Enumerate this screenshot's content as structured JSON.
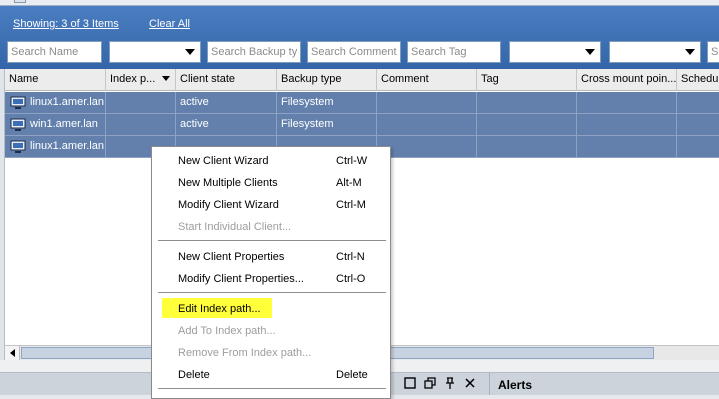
{
  "filter_bar": {
    "showing_label": "Showing: 3 of 3 Items",
    "clear_all_label": "Clear All",
    "search_name_placeholder": "Search Name",
    "search_backup_type_placeholder": "Search Backup typ",
    "search_comment_placeholder": "Search Comment",
    "search_tag_placeholder": "Search Tag",
    "search_last_placeholder": "Se"
  },
  "table": {
    "columns": [
      "Name",
      "Index p...",
      "Client state",
      "Backup type",
      "Comment",
      "Tag",
      "Cross mount poin...",
      "Schedu"
    ],
    "rows": [
      {
        "name": "linux1.amer.lan",
        "index_path": "",
        "client_state": "active",
        "backup_type": "Filesystem",
        "comment": "",
        "tag": "",
        "cross_mount": "",
        "schedule": ""
      },
      {
        "name": "win1.amer.lan",
        "index_path": "",
        "client_state": "active",
        "backup_type": "Filesystem",
        "comment": "",
        "tag": "",
        "cross_mount": "",
        "schedule": ""
      },
      {
        "name": "linux1.amer.lan",
        "index_path": "",
        "client_state": "",
        "backup_type": "",
        "comment": "",
        "tag": "",
        "cross_mount": "",
        "schedule": ""
      }
    ]
  },
  "context_menu": {
    "items": [
      {
        "label": "New Client Wizard",
        "shortcut": "Ctrl-W"
      },
      {
        "label": "New Multiple Clients",
        "shortcut": "Alt-M"
      },
      {
        "label": "Modify Client Wizard",
        "shortcut": "Ctrl-M"
      },
      {
        "label": "Start Individual Client...",
        "shortcut": ""
      },
      {
        "label": "New Client Properties",
        "shortcut": "Ctrl-N"
      },
      {
        "label": "Modify Client Properties...",
        "shortcut": "Ctrl-O"
      },
      {
        "label": "Edit Index path...",
        "shortcut": ""
      },
      {
        "label": "Add To Index path...",
        "shortcut": ""
      },
      {
        "label": "Remove From Index path...",
        "shortcut": ""
      },
      {
        "label": "Delete",
        "shortcut": "Delete"
      }
    ]
  },
  "bottom_panel": {
    "alerts_label": "Alerts"
  },
  "colors": {
    "toolbar_blue": "#3d72b8",
    "selected_row": "#6380ad",
    "highlight_yellow": "#ffff3a"
  }
}
